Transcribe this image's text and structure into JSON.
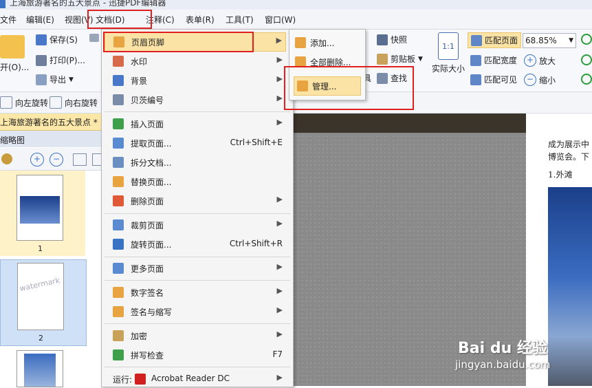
{
  "window": {
    "title": "上海旅游著名的五大景点 - 迅捷PDF编辑器"
  },
  "menubar": {
    "items": [
      "文件",
      "编辑(E)",
      "视图(V)",
      "文档(D)",
      "注释(C)",
      "表单(R)",
      "工具(T)",
      "窗口(W)"
    ]
  },
  "toolbar": {
    "open": "开(O)...",
    "save": "保存(S)",
    "print": "打印(P)...",
    "export": "导出",
    "snapshot": "快照",
    "clipboard": "剪贴板",
    "find": "查找",
    "tools_partial": "具",
    "actual_size": "实际大小",
    "actual_size_icon": "1:1",
    "fit_page": "匹配页面",
    "fit_width": "匹配宽度",
    "fit_visible": "匹配可见",
    "zoom_value": "68.85%",
    "zoom_in": "放大",
    "zoom_out": "缩小",
    "rotate_left": "向左旋转",
    "rotate_right": "向右旋转"
  },
  "doc_tab": "上海旅游著名的五大景点 *",
  "thumbnail_panel": {
    "title": "缩略图",
    "pages": [
      "1",
      "2"
    ],
    "watermark": "watermark"
  },
  "document_menu": {
    "items": [
      {
        "label": "页眉页脚",
        "shortcut": ""
      },
      {
        "label": "水印",
        "shortcut": ""
      },
      {
        "label": "背景",
        "shortcut": ""
      },
      {
        "label": "贝茨编号",
        "shortcut": ""
      },
      {
        "label": "插入页面",
        "shortcut": ""
      },
      {
        "label": "提取页面...",
        "shortcut": "Ctrl+Shift+E"
      },
      {
        "label": "拆分文档...",
        "shortcut": ""
      },
      {
        "label": "替换页面...",
        "shortcut": ""
      },
      {
        "label": "删除页面",
        "shortcut": ""
      },
      {
        "label": "裁剪页面",
        "shortcut": ""
      },
      {
        "label": "旋转页面...",
        "shortcut": "Ctrl+Shift+R"
      },
      {
        "label": "更多页面",
        "shortcut": ""
      },
      {
        "label": "数字签名",
        "shortcut": ""
      },
      {
        "label": "签名与缩写",
        "shortcut": ""
      },
      {
        "label": "加密",
        "shortcut": ""
      },
      {
        "label": "拼写检查",
        "shortcut": "F7"
      },
      {
        "label": "运行:",
        "shortcut": ""
      }
    ],
    "run_app": "Acrobat Reader DC"
  },
  "header_footer_submenu": {
    "items": [
      "添加...",
      "全部删除...",
      "管理..."
    ]
  },
  "document_page": {
    "lines": [
      "成为展示中",
      "博览会。下",
      "1.外滩"
    ]
  },
  "watermark_site": {
    "logo": "Bai du 经验",
    "url": "jingyan.baidu.com"
  },
  "colors": {
    "highlight": "#fbe3a5",
    "annotation_red": "#e02020",
    "accent_blue": "#3b73c4"
  }
}
